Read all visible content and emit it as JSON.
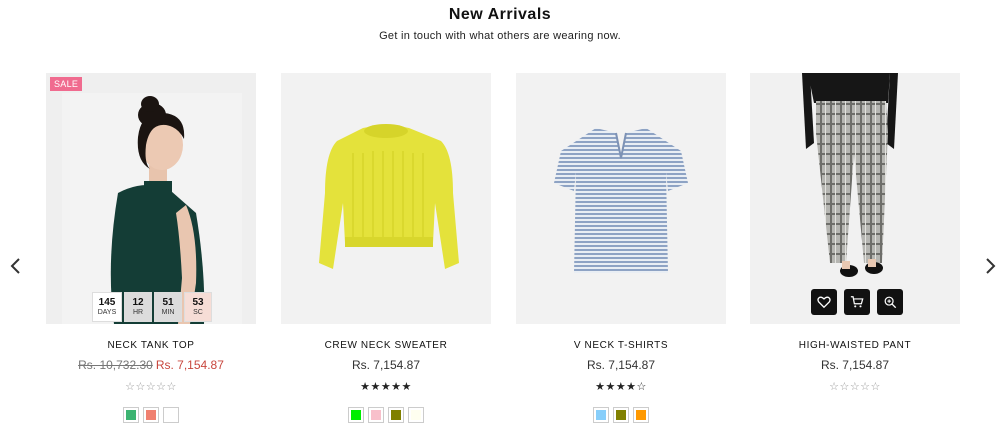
{
  "header": {
    "title": "New Arrivals",
    "subtitle": "Get in touch with what others are wearing now."
  },
  "carousel": {
    "prev_icon": "chevron-left-icon",
    "next_icon": "chevron-right-icon"
  },
  "products": [
    {
      "name": "NECK TANK TOP",
      "badge": "SALE",
      "old_price": "Rs. 10,732.30",
      "price": "Rs. 7,154.87",
      "rating": 0,
      "stars": "☆☆☆☆☆",
      "countdown": [
        {
          "value": "145",
          "label": "DAYS"
        },
        {
          "value": "12",
          "label": "HR"
        },
        {
          "value": "51",
          "label": "MIN"
        },
        {
          "value": "53",
          "label": "SC"
        }
      ],
      "swatches": [
        "#3cb371",
        "#f08070",
        "#ffffff"
      ]
    },
    {
      "name": "CREW NECK SWEATER",
      "price": "Rs. 7,154.87",
      "rating": 5,
      "stars": "★★★★★",
      "swatches": [
        "#00ee00",
        "#f8c0cb",
        "#808000",
        "#fffff0"
      ]
    },
    {
      "name": "V NECK T-SHIRTS",
      "price": "Rs. 7,154.87",
      "rating": 4,
      "stars": "★★★★☆",
      "swatches": [
        "#87cefa",
        "#808000",
        "#ff9900"
      ]
    },
    {
      "name": "HIGH-WAISTED PANT",
      "price": "Rs. 7,154.87",
      "rating": 0,
      "stars": "☆☆☆☆☆",
      "actions": [
        "heart-icon",
        "cart-icon",
        "zoom-in-icon"
      ],
      "swatches": []
    }
  ],
  "colors": {
    "sale_badge": "#f06b8f",
    "sale_price": "#c8463d",
    "action_button": "#111111"
  }
}
